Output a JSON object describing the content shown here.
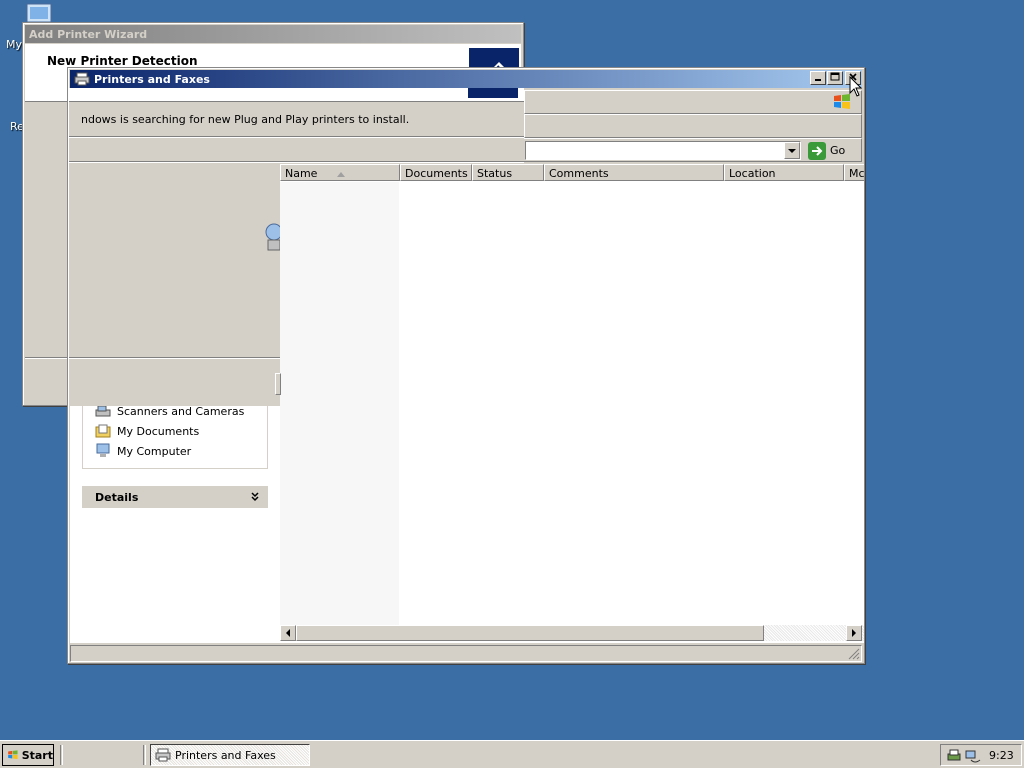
{
  "desktop": {
    "icon_my_label": "My",
    "icon_re_label": "Re"
  },
  "wizard": {
    "title": "Add Printer Wizard",
    "heading": "New Printer Detection",
    "status_text": "ndows is searching for new Plug and Play printers to install."
  },
  "printers_window": {
    "title": "Printers and Faxes",
    "address": {
      "value": "",
      "go_label": "Go"
    },
    "columns": [
      "Name",
      "Documents",
      "Status",
      "Comments",
      "Location",
      "Mc"
    ],
    "other_places": [
      "Scanners and Cameras",
      "My Documents",
      "My Computer"
    ],
    "details_label": "Details"
  },
  "taskbar": {
    "start_label": "Start",
    "window_button": "Printers and Faxes",
    "clock": "9:23"
  },
  "colors": {
    "desktop": "#3a6ea5",
    "title_active": "#0a246a",
    "face": "#d4d0c8"
  }
}
